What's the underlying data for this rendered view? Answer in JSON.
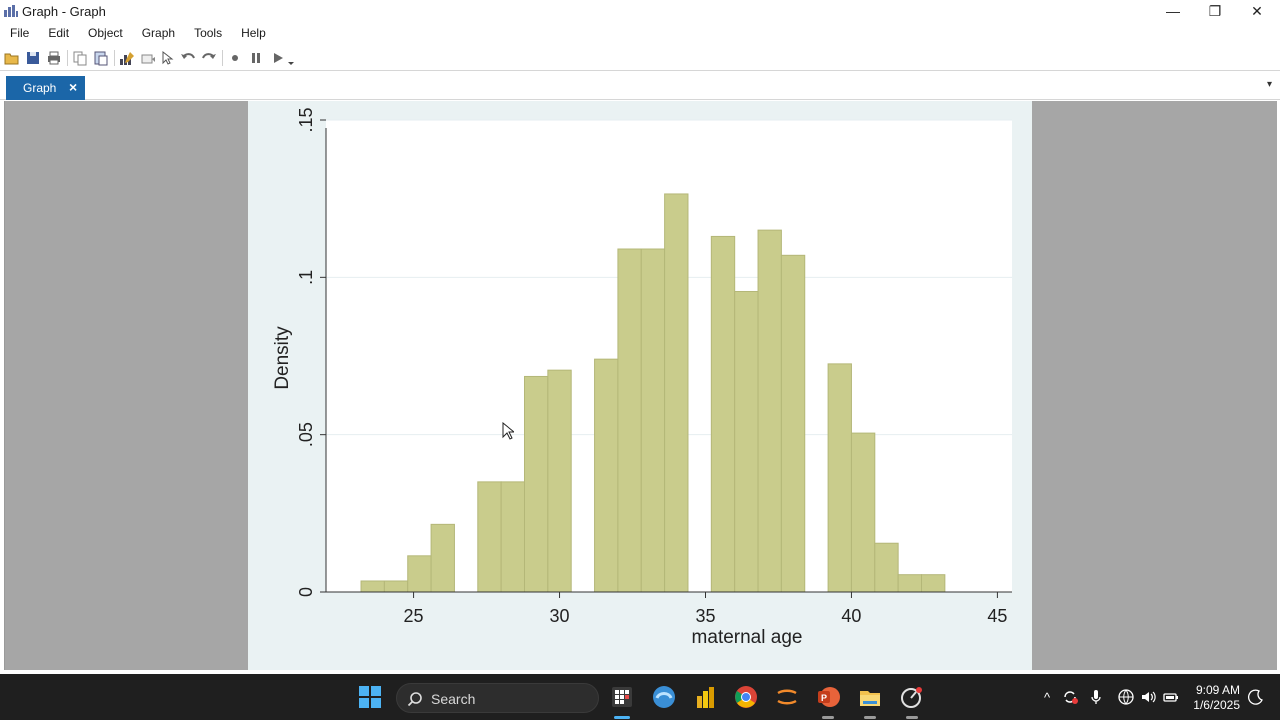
{
  "window": {
    "title": "Graph - Graph",
    "minimize_glyph": "—",
    "maximize_glyph": "❐",
    "close_glyph": "✕"
  },
  "menu": [
    "File",
    "Edit",
    "Object",
    "Graph",
    "Tools",
    "Help"
  ],
  "toolbar_icons": [
    "open-icon",
    "save-icon",
    "print-icon",
    "copy-icon",
    "paste-icon",
    "graph-editor-icon",
    "graph-recorder-icon",
    "pointer-icon",
    "undo-icon",
    "redo-icon",
    "record-icon",
    "pause-icon",
    "play-icon"
  ],
  "tabs": [
    {
      "label": "Graph",
      "close": "×"
    }
  ],
  "tab_dropdown_glyph": "▾",
  "colors": {
    "accent": "#1b66a8",
    "bar_fill": "#c9cc8c",
    "bar_stroke": "#b4b778",
    "plot_bg": "#ffffff",
    "graph_region_bg": "#eaf2f3",
    "workspace_bg": "#a6a6a6",
    "taskbar_bg": "#1f1f1f"
  },
  "chart_data": {
    "type": "bar",
    "title": "",
    "xlabel": "maternal age",
    "ylabel": "Density",
    "xlim": [
      22,
      45.5
    ],
    "ylim": [
      0,
      0.15
    ],
    "xticks": [
      25,
      30,
      35,
      40,
      45
    ],
    "xtick_labels": [
      "25",
      "30",
      "35",
      "40",
      "45"
    ],
    "yticks": [
      0,
      0.05,
      0.1,
      0.15
    ],
    "ytick_labels": [
      "0",
      ".05",
      ".1",
      ".15"
    ],
    "grid": true,
    "legend": "none",
    "bin_width": 0.8,
    "bins": [
      {
        "x0": 23.2,
        "density": 0.0035
      },
      {
        "x0": 24.0,
        "density": 0.0035
      },
      {
        "x0": 24.8,
        "density": 0.0115
      },
      {
        "x0": 25.6,
        "density": 0.0215
      },
      {
        "x0": 27.2,
        "density": 0.035
      },
      {
        "x0": 28.0,
        "density": 0.035
      },
      {
        "x0": 28.8,
        "density": 0.0685
      },
      {
        "x0": 29.6,
        "density": 0.0705
      },
      {
        "x0": 31.2,
        "density": 0.074
      },
      {
        "x0": 32.0,
        "density": 0.109
      },
      {
        "x0": 32.8,
        "density": 0.109
      },
      {
        "x0": 33.6,
        "density": 0.1265
      },
      {
        "x0": 35.2,
        "density": 0.113
      },
      {
        "x0": 36.0,
        "density": 0.0955
      },
      {
        "x0": 36.8,
        "density": 0.115
      },
      {
        "x0": 37.6,
        "density": 0.107
      },
      {
        "x0": 39.2,
        "density": 0.0725
      },
      {
        "x0": 40.0,
        "density": 0.0505
      },
      {
        "x0": 40.8,
        "density": 0.0155
      },
      {
        "x0": 41.6,
        "density": 0.0055
      },
      {
        "x0": 42.4,
        "density": 0.0055
      }
    ]
  },
  "taskbar": {
    "search_placeholder": "Search",
    "apps": [
      "windows-start-icon",
      "stata-icon",
      "edge-browser-icon",
      "power-bi-icon",
      "chrome-icon",
      "vpn-icon",
      "powerpoint-icon",
      "file-explorer-icon",
      "snipping-tool-icon"
    ],
    "tray": {
      "time": "9:09 AM",
      "date": "1/6/2025"
    }
  }
}
